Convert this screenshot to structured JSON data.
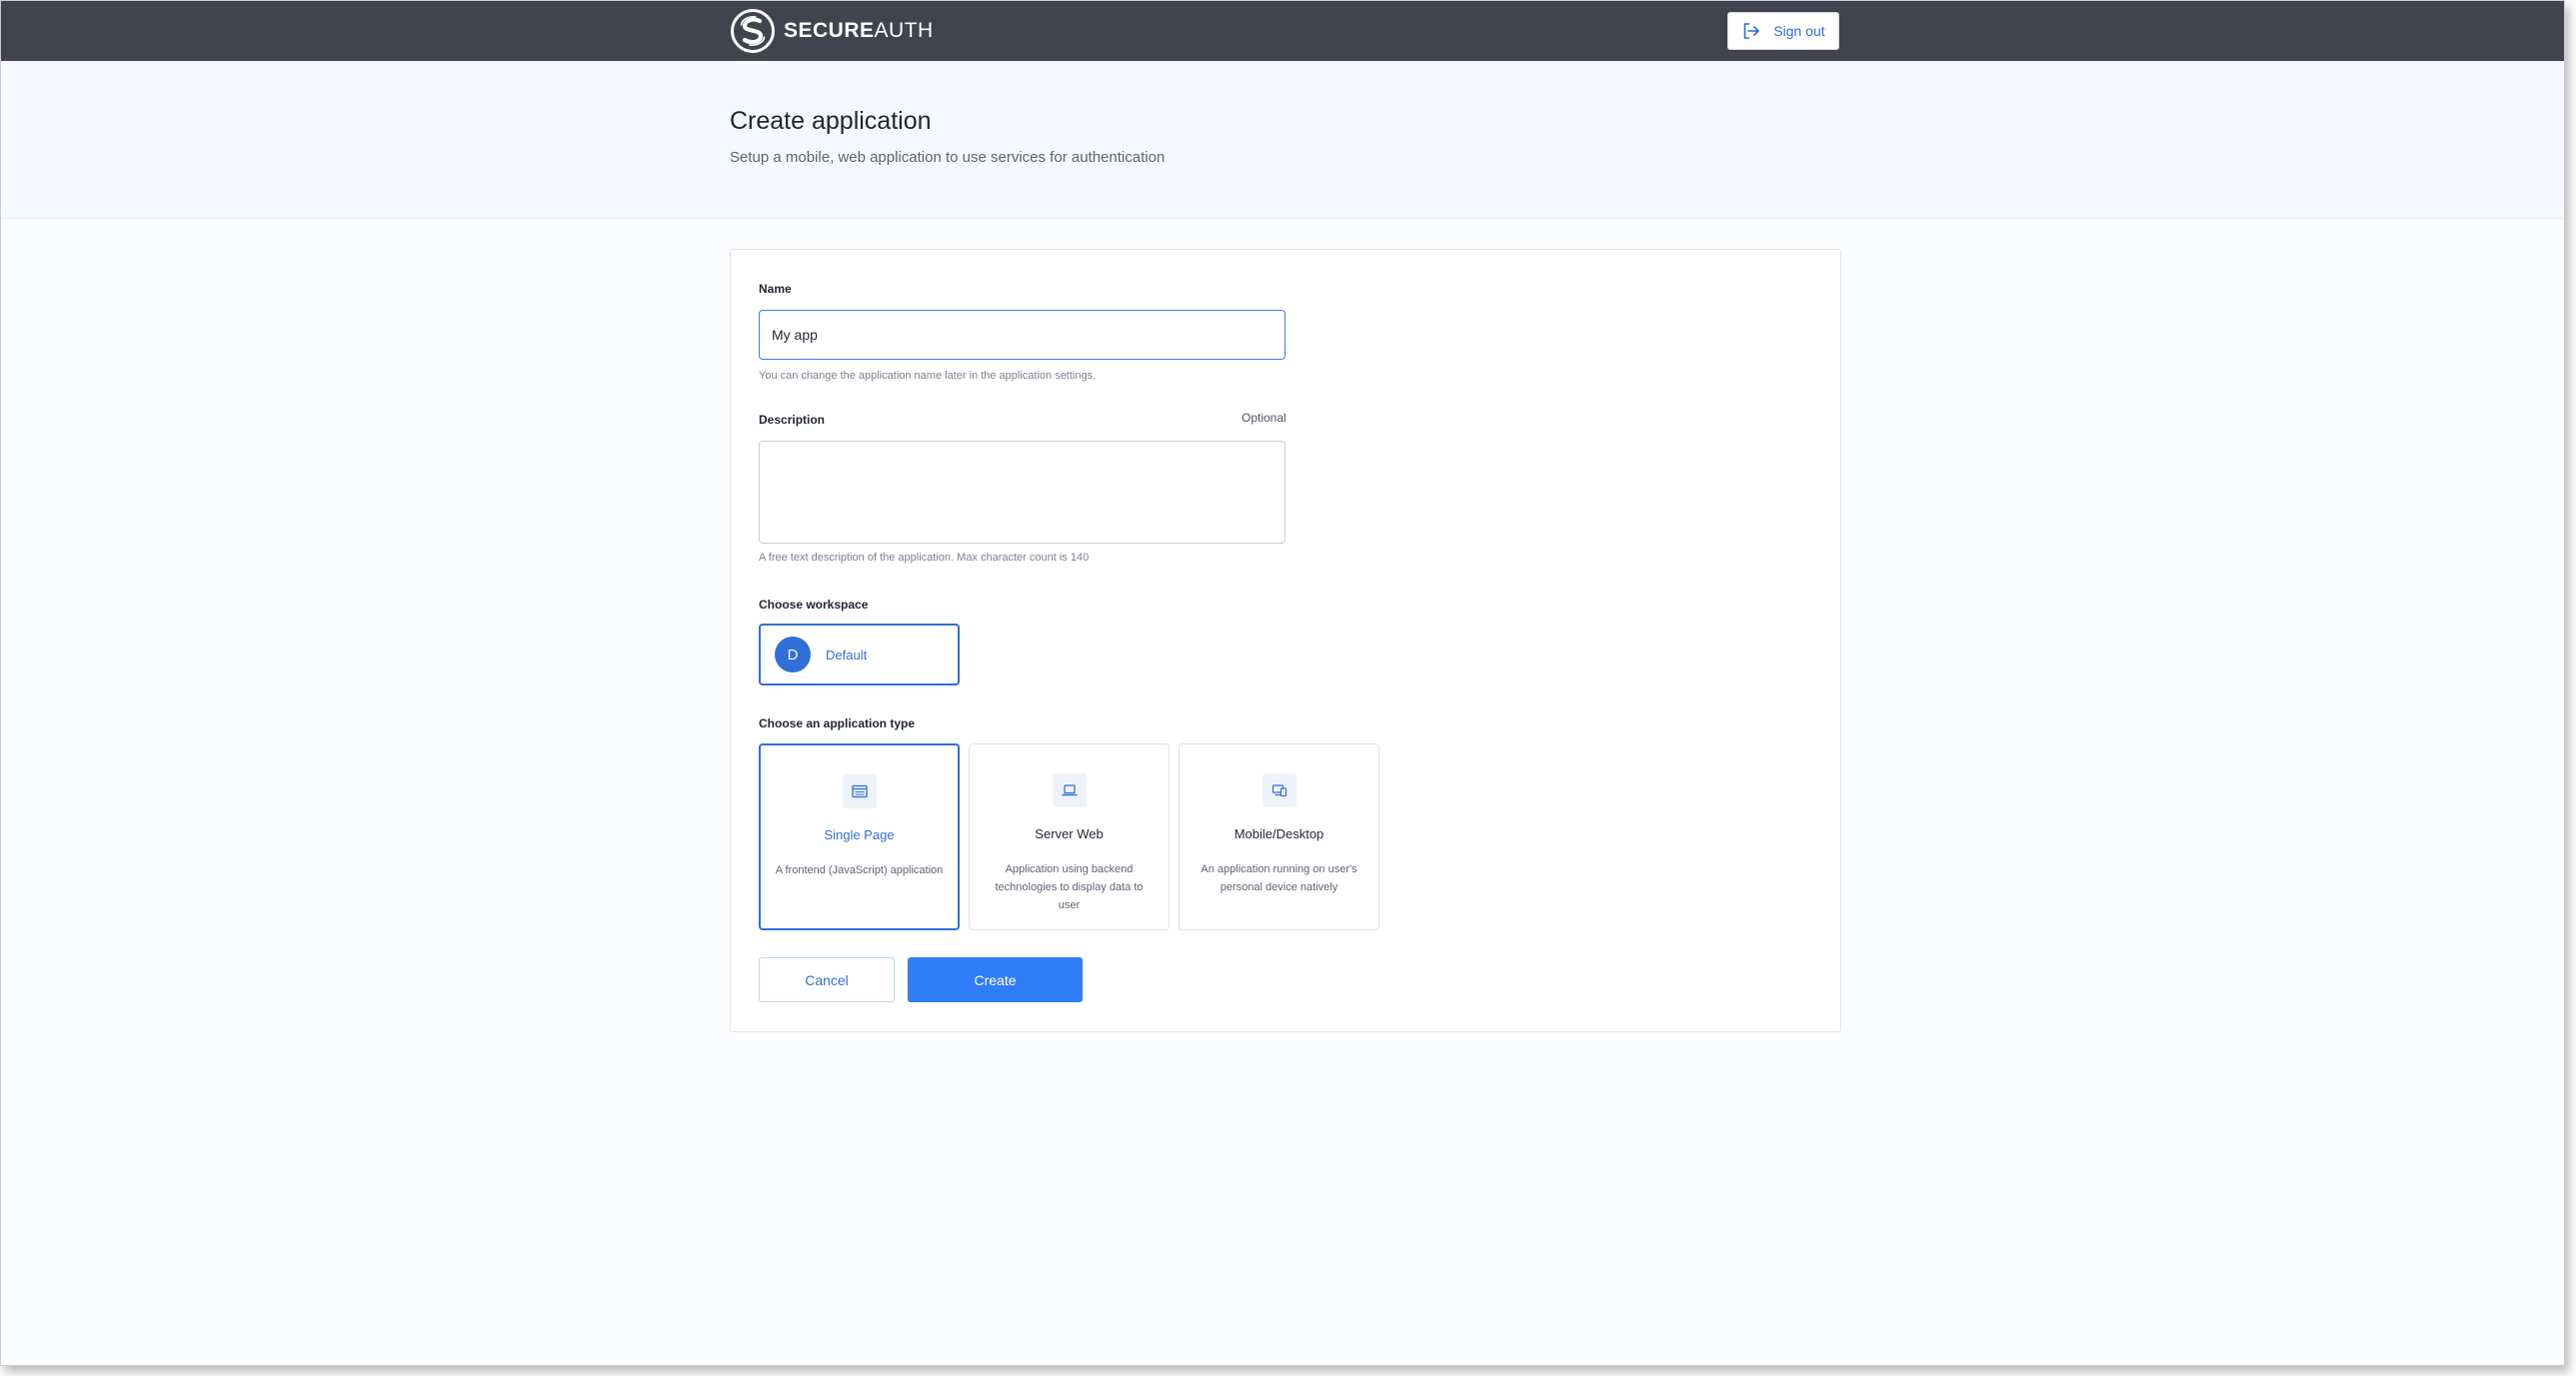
{
  "brand": {
    "name_bold": "SECURE",
    "name_light": "AUTH",
    "logo_icon": "secureauth-logo-icon"
  },
  "topbar": {
    "signout_label": "Sign out",
    "signout_icon": "sign-out-icon"
  },
  "header": {
    "title": "Create application",
    "subtitle": "Setup a mobile, web application to use services for authentication"
  },
  "form": {
    "name": {
      "label": "Name",
      "value": "My app",
      "helper": "You can change the application name later in the application settings."
    },
    "description": {
      "label": "Description",
      "optional": "Optional",
      "value": "",
      "helper": "A free text description of the application. Max character count is 140"
    },
    "workspace": {
      "label": "Choose workspace",
      "selected": {
        "initial": "D",
        "name": "Default"
      }
    },
    "app_type": {
      "label": "Choose an application type",
      "options": [
        {
          "title": "Single Page",
          "desc": "A frontend (JavaScript) application",
          "icon": "browser-window-icon",
          "selected": true
        },
        {
          "title": "Server Web",
          "desc": "Application using backend technologies to display data to user",
          "icon": "laptop-icon",
          "selected": false
        },
        {
          "title": "Mobile/Desktop",
          "desc": "An application running on user's personal device natively",
          "icon": "devices-icon",
          "selected": false
        }
      ]
    },
    "actions": {
      "cancel": "Cancel",
      "create": "Create"
    }
  },
  "colors": {
    "accent": "#2f7cf6",
    "topbar": "#41444f",
    "header_bg": "#f5f8fc"
  }
}
